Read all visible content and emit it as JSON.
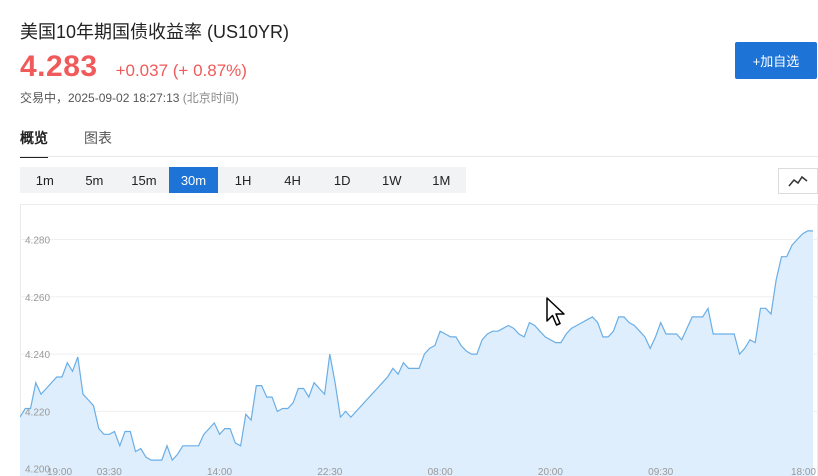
{
  "header": {
    "title": "美国10年期国债收益率 (US10YR)",
    "price": "4.283",
    "change": "+0.037 (+ 0.87%)",
    "status": "交易中，2025-09-02 18:27:13",
    "timezone": "(北京时间)",
    "add_button": "+加自选"
  },
  "tabs": [
    {
      "label": "概览",
      "active": true
    },
    {
      "label": "图表",
      "active": false
    }
  ],
  "intervals": [
    {
      "label": "1m",
      "active": false
    },
    {
      "label": "5m",
      "active": false
    },
    {
      "label": "15m",
      "active": false
    },
    {
      "label": "30m",
      "active": true
    },
    {
      "label": "1H",
      "active": false
    },
    {
      "label": "4H",
      "active": false
    },
    {
      "label": "1D",
      "active": false
    },
    {
      "label": "1W",
      "active": false
    },
    {
      "label": "1M",
      "active": false
    }
  ],
  "icons": {
    "chart_type": "line-chart-icon",
    "cursor": "mouse-pointer-icon"
  },
  "colors": {
    "accent": "#1e73d6",
    "up": "#f05a5a",
    "line": "#6aaee6",
    "area": "#deeefc"
  },
  "chart_data": {
    "type": "area",
    "x_ticks": [
      {
        "label": "19:00",
        "index": 0
      },
      {
        "label": "03:30",
        "index": 17
      },
      {
        "label": "14:00",
        "index": 38
      },
      {
        "label": "22:30",
        "index": 59
      },
      {
        "label": "08:00",
        "index": 80
      },
      {
        "label": "20:00",
        "index": 101
      },
      {
        "label": "09:30",
        "index": 122
      },
      {
        "label": "18:00",
        "index": 143
      }
    ],
    "y_ticks": [
      4.2,
      4.22,
      4.24,
      4.26,
      4.28
    ],
    "y_tick_labels": [
      "4.200",
      "4.220",
      "4.240",
      "4.260",
      "4.280"
    ],
    "ylim": [
      4.2,
      4.288
    ],
    "grid": true,
    "values": [
      4.218,
      4.221,
      4.221,
      4.23,
      4.226,
      4.228,
      4.23,
      4.232,
      4.232,
      4.237,
      4.234,
      4.239,
      4.226,
      4.224,
      4.222,
      4.214,
      4.212,
      4.212,
      4.213,
      4.208,
      4.213,
      4.213,
      4.206,
      4.207,
      4.204,
      4.203,
      4.203,
      4.203,
      4.208,
      4.203,
      4.205,
      4.208,
      4.208,
      4.208,
      4.208,
      4.212,
      4.214,
      4.216,
      4.212,
      4.214,
      4.214,
      4.209,
      4.208,
      4.219,
      4.217,
      4.229,
      4.229,
      4.225,
      4.225,
      4.22,
      4.221,
      4.221,
      4.223,
      4.228,
      4.228,
      4.225,
      4.23,
      4.228,
      4.226,
      4.24,
      4.23,
      4.218,
      4.22,
      4.218,
      4.22,
      4.222,
      4.224,
      4.226,
      4.228,
      4.23,
      4.232,
      4.235,
      4.233,
      4.237,
      4.235,
      4.235,
      4.235,
      4.24,
      4.242,
      4.243,
      4.248,
      4.247,
      4.246,
      4.246,
      4.243,
      4.241,
      4.24,
      4.24,
      4.245,
      4.247,
      4.248,
      4.248,
      4.249,
      4.25,
      4.249,
      4.247,
      4.246,
      4.251,
      4.25,
      4.248,
      4.246,
      4.245,
      4.244,
      4.244,
      4.247,
      4.249,
      4.25,
      4.251,
      4.252,
      4.253,
      4.251,
      4.246,
      4.246,
      4.248,
      4.253,
      4.253,
      4.251,
      4.25,
      4.248,
      4.246,
      4.242,
      4.246,
      4.251,
      4.247,
      4.247,
      4.247,
      4.245,
      4.249,
      4.253,
      4.253,
      4.253,
      4.256,
      4.247,
      4.247,
      4.247,
      4.247,
      4.247,
      4.24,
      4.242,
      4.245,
      4.244,
      4.256,
      4.256,
      4.254,
      4.266,
      4.274,
      4.274,
      4.278,
      4.28,
      4.282,
      4.283,
      4.283
    ]
  }
}
